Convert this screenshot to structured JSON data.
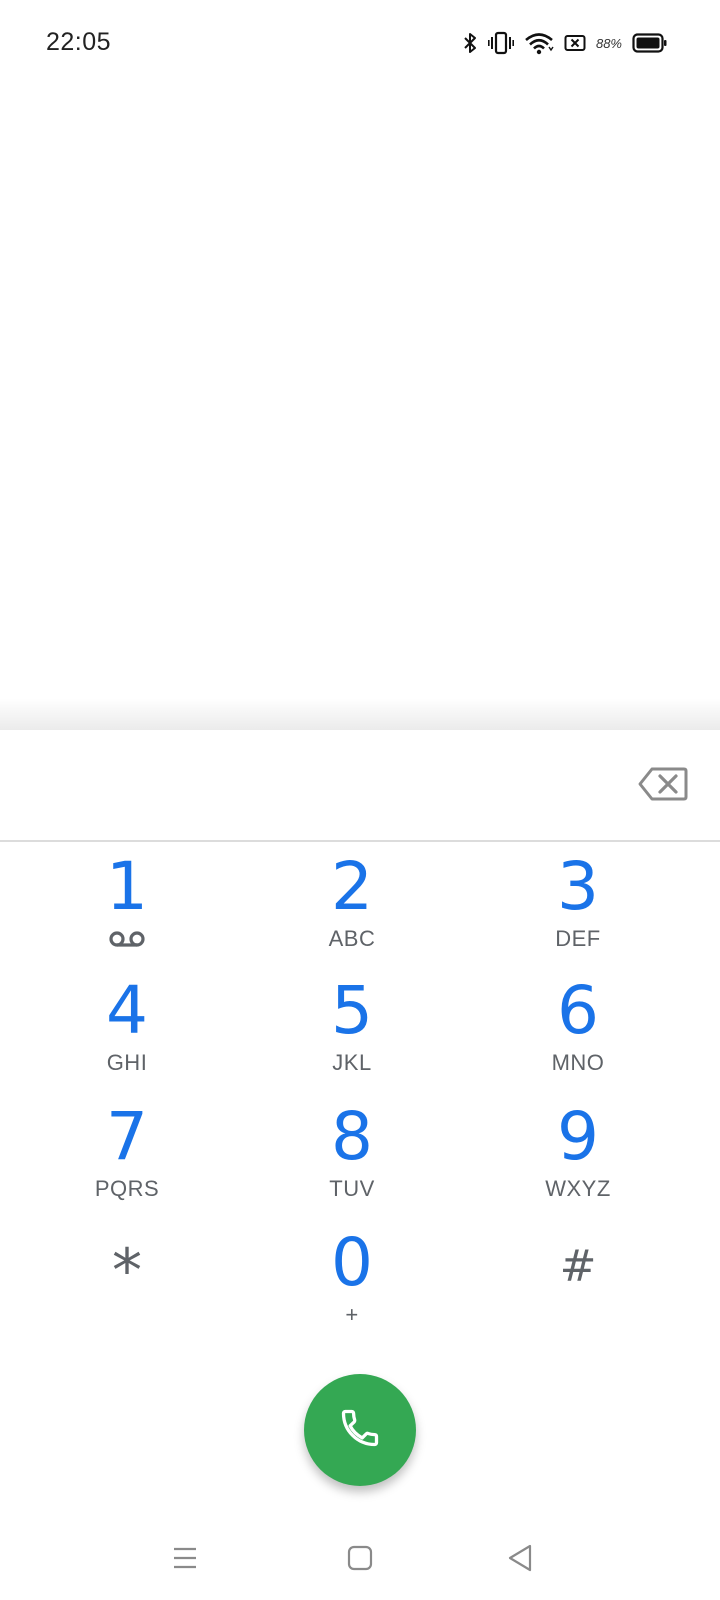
{
  "status_bar": {
    "time": "22:05",
    "battery_percent": "88%",
    "icons": [
      "bluetooth-icon",
      "vibrate-icon",
      "wifi-icon",
      "no-sim-icon",
      "battery-icon"
    ]
  },
  "dialpad": {
    "digits": "",
    "backspace_icon": "backspace-icon",
    "accent_color": "#1a73e8",
    "secondary_color": "#5f6368",
    "keys": [
      {
        "digit": "1",
        "letters": "",
        "extra_icon": "voicemail-icon"
      },
      {
        "digit": "2",
        "letters": "ABC"
      },
      {
        "digit": "3",
        "letters": "DEF"
      },
      {
        "digit": "4",
        "letters": "GHI"
      },
      {
        "digit": "5",
        "letters": "JKL"
      },
      {
        "digit": "6",
        "letters": "MNO"
      },
      {
        "digit": "7",
        "letters": "PQRS"
      },
      {
        "digit": "8",
        "letters": "TUV"
      },
      {
        "digit": "9",
        "letters": "WXYZ"
      },
      {
        "digit": "*",
        "letters": ""
      },
      {
        "digit": "0",
        "letters": "+"
      },
      {
        "digit": "#",
        "letters": ""
      }
    ]
  },
  "call_button": {
    "icon": "phone-icon",
    "color": "#34a853"
  },
  "nav_bar": {
    "buttons": [
      "menu-icon",
      "home-icon",
      "back-icon"
    ]
  }
}
